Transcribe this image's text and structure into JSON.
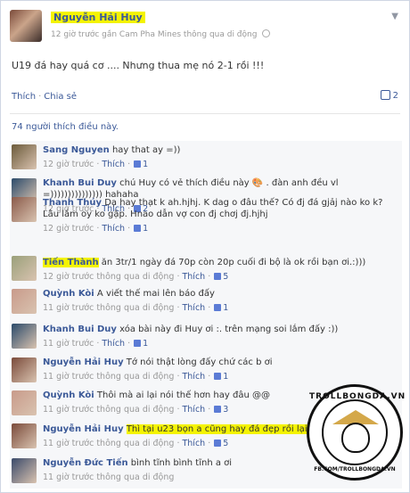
{
  "post": {
    "author": "Nguyễn Hải Huy",
    "meta": "12 giờ trước gần Cam Pha Mines thông qua di động",
    "text": "U19 đá hay quá cơ .... Nhưng thua mẹ nó 2-1 rồi !!!",
    "actions": {
      "like": "Thích",
      "share": "Chia sẻ"
    },
    "share_count": "2",
    "likes_summary": "74 người thích điều này."
  },
  "comments": [
    {
      "name": "Sang Nguyen",
      "text": "hay that ay =))",
      "time": "12 giờ trước",
      "like": "Thích",
      "likes": "1",
      "highlight_name": false,
      "highlight_text": false,
      "avatar_color": "#6b5a3a"
    },
    {
      "name": "Khanh Bui Duy",
      "text": "chú Huy có vẻ thích điều này 🎨 . đàn anh đều vl =))))))))))))))) hahaha",
      "time": "12 giờ trước",
      "like": "Thích",
      "likes": "2",
      "highlight_name": false,
      "highlight_text": false,
      "avatar_color": "#2a4a6a"
    },
    {
      "name": "Thanh Thúy",
      "text": "Dạ hay thạt k ah.hjhj. K dag o đâu thế? Có đj đá gjảj nào ko k? Lâu lắm oy ko gặp. Hnao dẫn vợ con đj chơj đj.hjhj",
      "time": "12 giờ trước",
      "like": "Thích",
      "likes": "1",
      "highlight_name": false,
      "highlight_text": false,
      "avatar_color": "#8a5a4a"
    },
    {
      "name": "Tiến Thành",
      "text": "ăn 3tr/1 ngày đá 70p còn 20p cuối đi bộ là ok rồi bạn ơi.:)))",
      "time": "12 giờ trước thông qua di động",
      "like": "Thích",
      "likes": "5",
      "highlight_name": true,
      "highlight_text": false,
      "avatar_color": "#9aa07a"
    },
    {
      "name": "Quỳnh Kòi",
      "text": "A viết thế mai lên báo đấy",
      "time": "11 giờ trước thông qua di động",
      "like": "Thích",
      "likes": "1",
      "highlight_name": false,
      "highlight_text": false,
      "avatar_color": "#c89a8a"
    },
    {
      "name": "Khanh Bui Duy",
      "text": "xóa bài này đi Huy ơi :. trên mạng soi lắm đấy :))",
      "time": "11 giờ trước",
      "like": "Thích",
      "likes": "1",
      "highlight_name": false,
      "highlight_text": false,
      "avatar_color": "#2a4a6a"
    },
    {
      "name": "Nguyễn Hải Huy",
      "text": "Tớ nói thật lòng đấy chứ các b ơi",
      "time": "11 giờ trước thông qua di động",
      "like": "Thích",
      "likes": "1",
      "highlight_name": false,
      "highlight_text": false,
      "avatar_color": "#7a4a3a"
    },
    {
      "name": "Quỳnh Kòi",
      "text": "Thôi mà ai lại nói thế hơn hay đâu @@",
      "time": "11 giờ trước thông qua di động",
      "like": "Thích",
      "likes": "3",
      "highlight_name": false,
      "highlight_text": false,
      "avatar_color": "#c89a8a"
    },
    {
      "name": "Nguyễn Hải Huy",
      "text": "Thì tại u23 bọn a cũng hay đá đẹp rồi lại thua mà",
      "time": "11 giờ trước thông qua di động",
      "like": "Thích",
      "likes": "5",
      "highlight_name": false,
      "highlight_text": true,
      "avatar_color": "#7a4a3a"
    },
    {
      "name": "Nguyễn Đức Tiến",
      "text": "bình tĩnh bình tĩnh a ơi",
      "time": "11 giờ trước thông qua di động",
      "like": "",
      "likes": "",
      "highlight_name": false,
      "highlight_text": false,
      "avatar_color": "#3a4a6a"
    }
  ],
  "watermark": {
    "top": "TROLLBONGDA.VN",
    "bottom": "FB.COM/TROLLBONGDA.VN"
  }
}
